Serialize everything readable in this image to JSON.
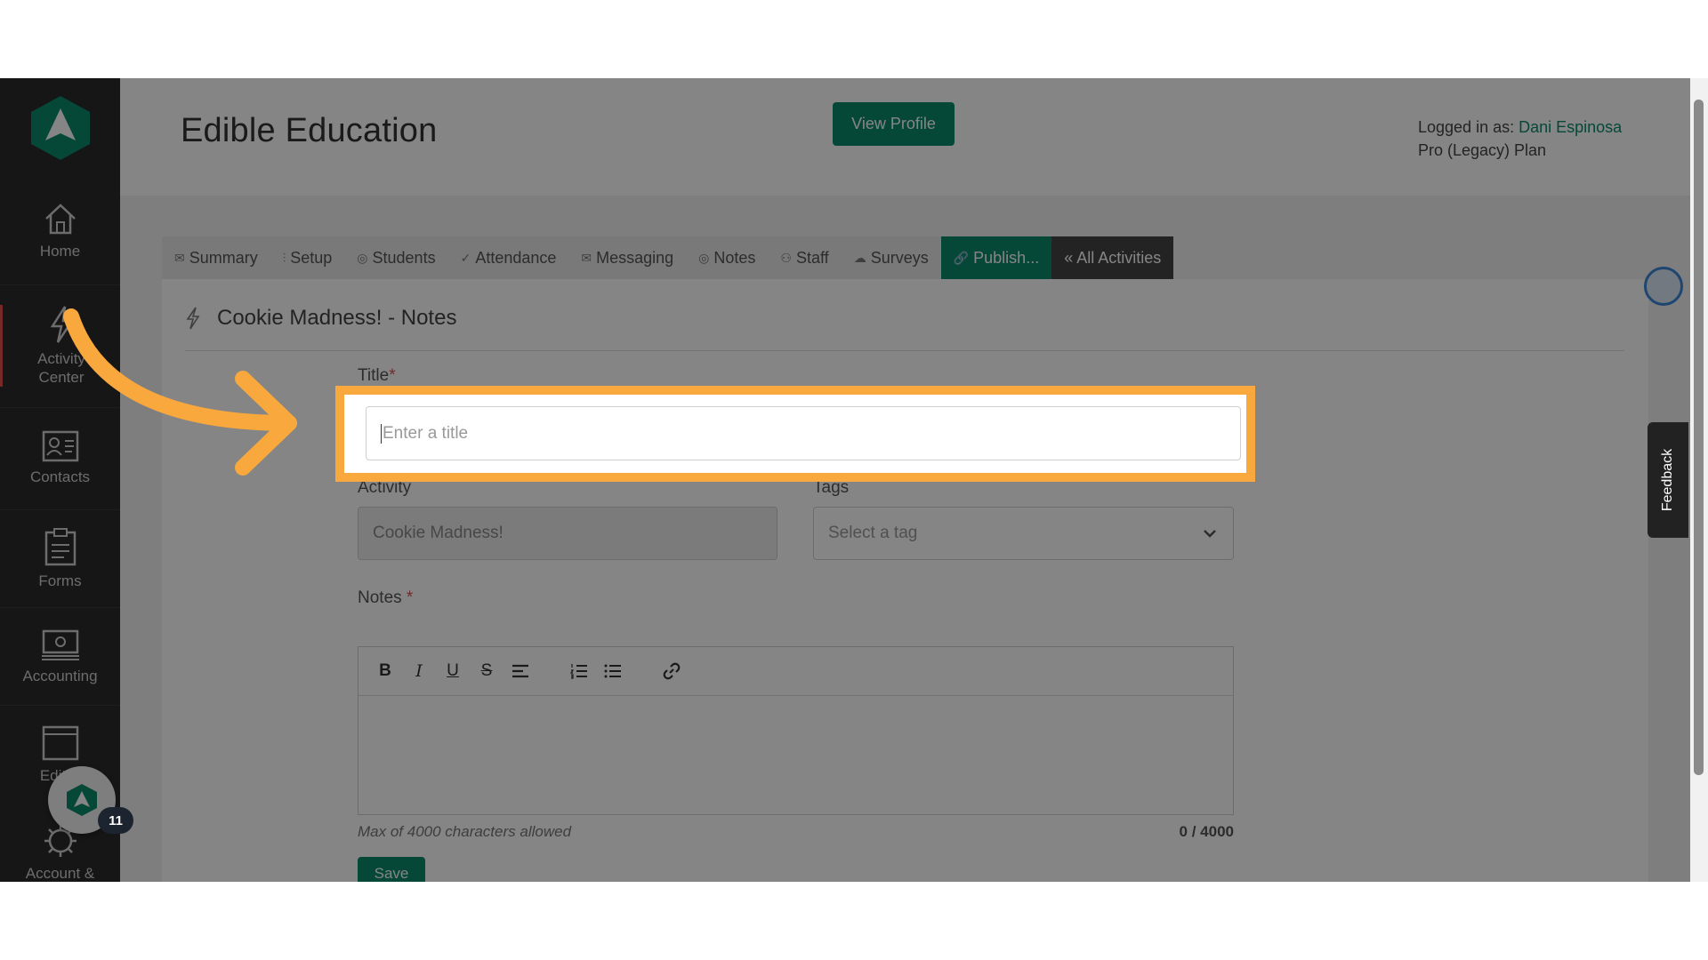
{
  "sidebar": {
    "items": [
      {
        "label": "Home",
        "icon": "home-icon"
      },
      {
        "label": "Activity Center",
        "label_line1": "Activity",
        "label_line2": "Center",
        "icon": "lightning-icon"
      },
      {
        "label": "Contacts",
        "icon": "contacts-icon"
      },
      {
        "label": "Forms",
        "icon": "clipboard-icon"
      },
      {
        "label": "Accounting",
        "icon": "money-icon"
      },
      {
        "label": "Edit P",
        "icon": "browser-window-icon"
      },
      {
        "label": "Account &",
        "icon": "gear-icon"
      }
    ]
  },
  "header": {
    "title": "Edible Education",
    "view_profile": "View Profile",
    "logged_in_prefix": "Logged in as: ",
    "user_name": "Dani Espinosa",
    "plan": "Pro (Legacy) Plan"
  },
  "tabs": [
    {
      "label": "Summary",
      "icon": "✉"
    },
    {
      "label": "Setup",
      "icon": "⫶"
    },
    {
      "label": "Students",
      "icon": "◎"
    },
    {
      "label": "Attendance",
      "icon": "✓"
    },
    {
      "label": "Messaging",
      "icon": "✉"
    },
    {
      "label": "Notes",
      "icon": "◎"
    },
    {
      "label": "Staff",
      "icon": "⚇"
    },
    {
      "label": "Surveys",
      "icon": "☁"
    },
    {
      "label": "Publish...",
      "icon": "🔗"
    },
    {
      "label": "« All Activities",
      "icon": ""
    }
  ],
  "form": {
    "section_title": "Cookie Madness! - Notes",
    "title_label": "Title",
    "title_placeholder": "Enter a title",
    "activity_label": "Activity",
    "activity_value": "Cookie Madness!",
    "tags_label": "Tags",
    "tags_placeholder": "Select a tag",
    "notes_label": "Notes",
    "required_mark": "*",
    "helper_text": "Max of 4000 characters allowed",
    "counter": "0 / 4000",
    "save_label": "Save"
  },
  "editor_toolbar": [
    "B",
    "I",
    "U",
    "S"
  ],
  "feedback_label": "Feedback",
  "chat_badge": "11",
  "colors": {
    "accent": "#0c8a6a",
    "highlight": "#f8a83c",
    "sidebar_bg": "#2b2b2b"
  }
}
